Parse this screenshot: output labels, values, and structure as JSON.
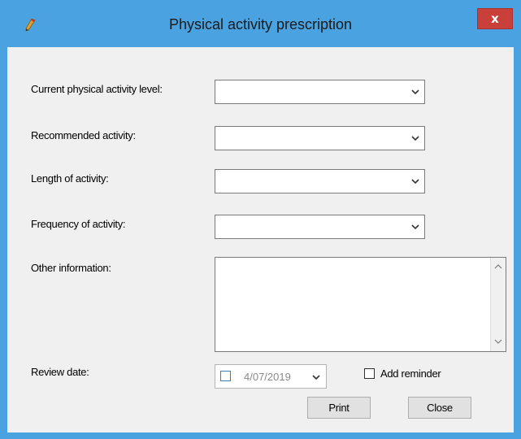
{
  "window": {
    "title": "Physical activity prescription",
    "close_glyph": "x",
    "icon": "pencil-icon"
  },
  "form": {
    "current_level_label": "Current physical activity level:",
    "current_level_value": "",
    "recommended_label": "Recommended activity:",
    "recommended_value": "",
    "length_label": "Length of activity:",
    "length_value": "",
    "frequency_label": "Frequency of activity:",
    "frequency_value": "",
    "other_label": "Other information:",
    "other_value": "",
    "review_label": "Review date:",
    "review_date": "4/07/2019",
    "add_reminder_label": "Add reminder"
  },
  "buttons": {
    "print": "Print",
    "close": "Close"
  },
  "colors": {
    "title_bar": "#4aa3e0",
    "close_button": "#c9403a",
    "background": "#f0f0f0"
  }
}
